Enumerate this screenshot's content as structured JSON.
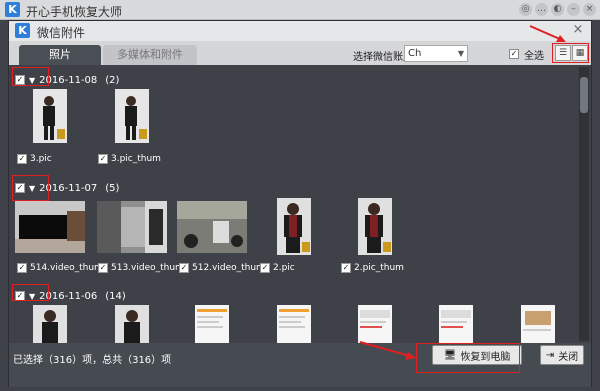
{
  "app": {
    "title": "开心手机恢复大师",
    "logo_letter": "K"
  },
  "dialog": {
    "title": "微信附件",
    "logo_letter": "K",
    "tabs": [
      {
        "label": "照片"
      },
      {
        "label": "多媒体和附件"
      }
    ],
    "account_label": "选择微信账户",
    "account_value": "Ch",
    "select_all_label": "全选"
  },
  "groups": [
    {
      "date": "2016-11-08",
      "count": "(2)",
      "items": [
        {
          "name": "3.pic"
        },
        {
          "name": "3.pic_thum"
        }
      ]
    },
    {
      "date": "2016-11-07",
      "count": "(5)",
      "items": [
        {
          "name": "514.video_thum"
        },
        {
          "name": "513.video_thum"
        },
        {
          "name": "512.video_thum"
        },
        {
          "name": "2.pic"
        },
        {
          "name": "2.pic_thum"
        }
      ]
    },
    {
      "date": "2016-11-06",
      "count": "(14)"
    }
  ],
  "footer": {
    "status": "已选择（316）项，总共（316）项",
    "recover_label": "恢复到电脑",
    "close_label": "关闭"
  },
  "colors": {
    "highlight": "#e02020",
    "brand": "#2f7ed8"
  }
}
